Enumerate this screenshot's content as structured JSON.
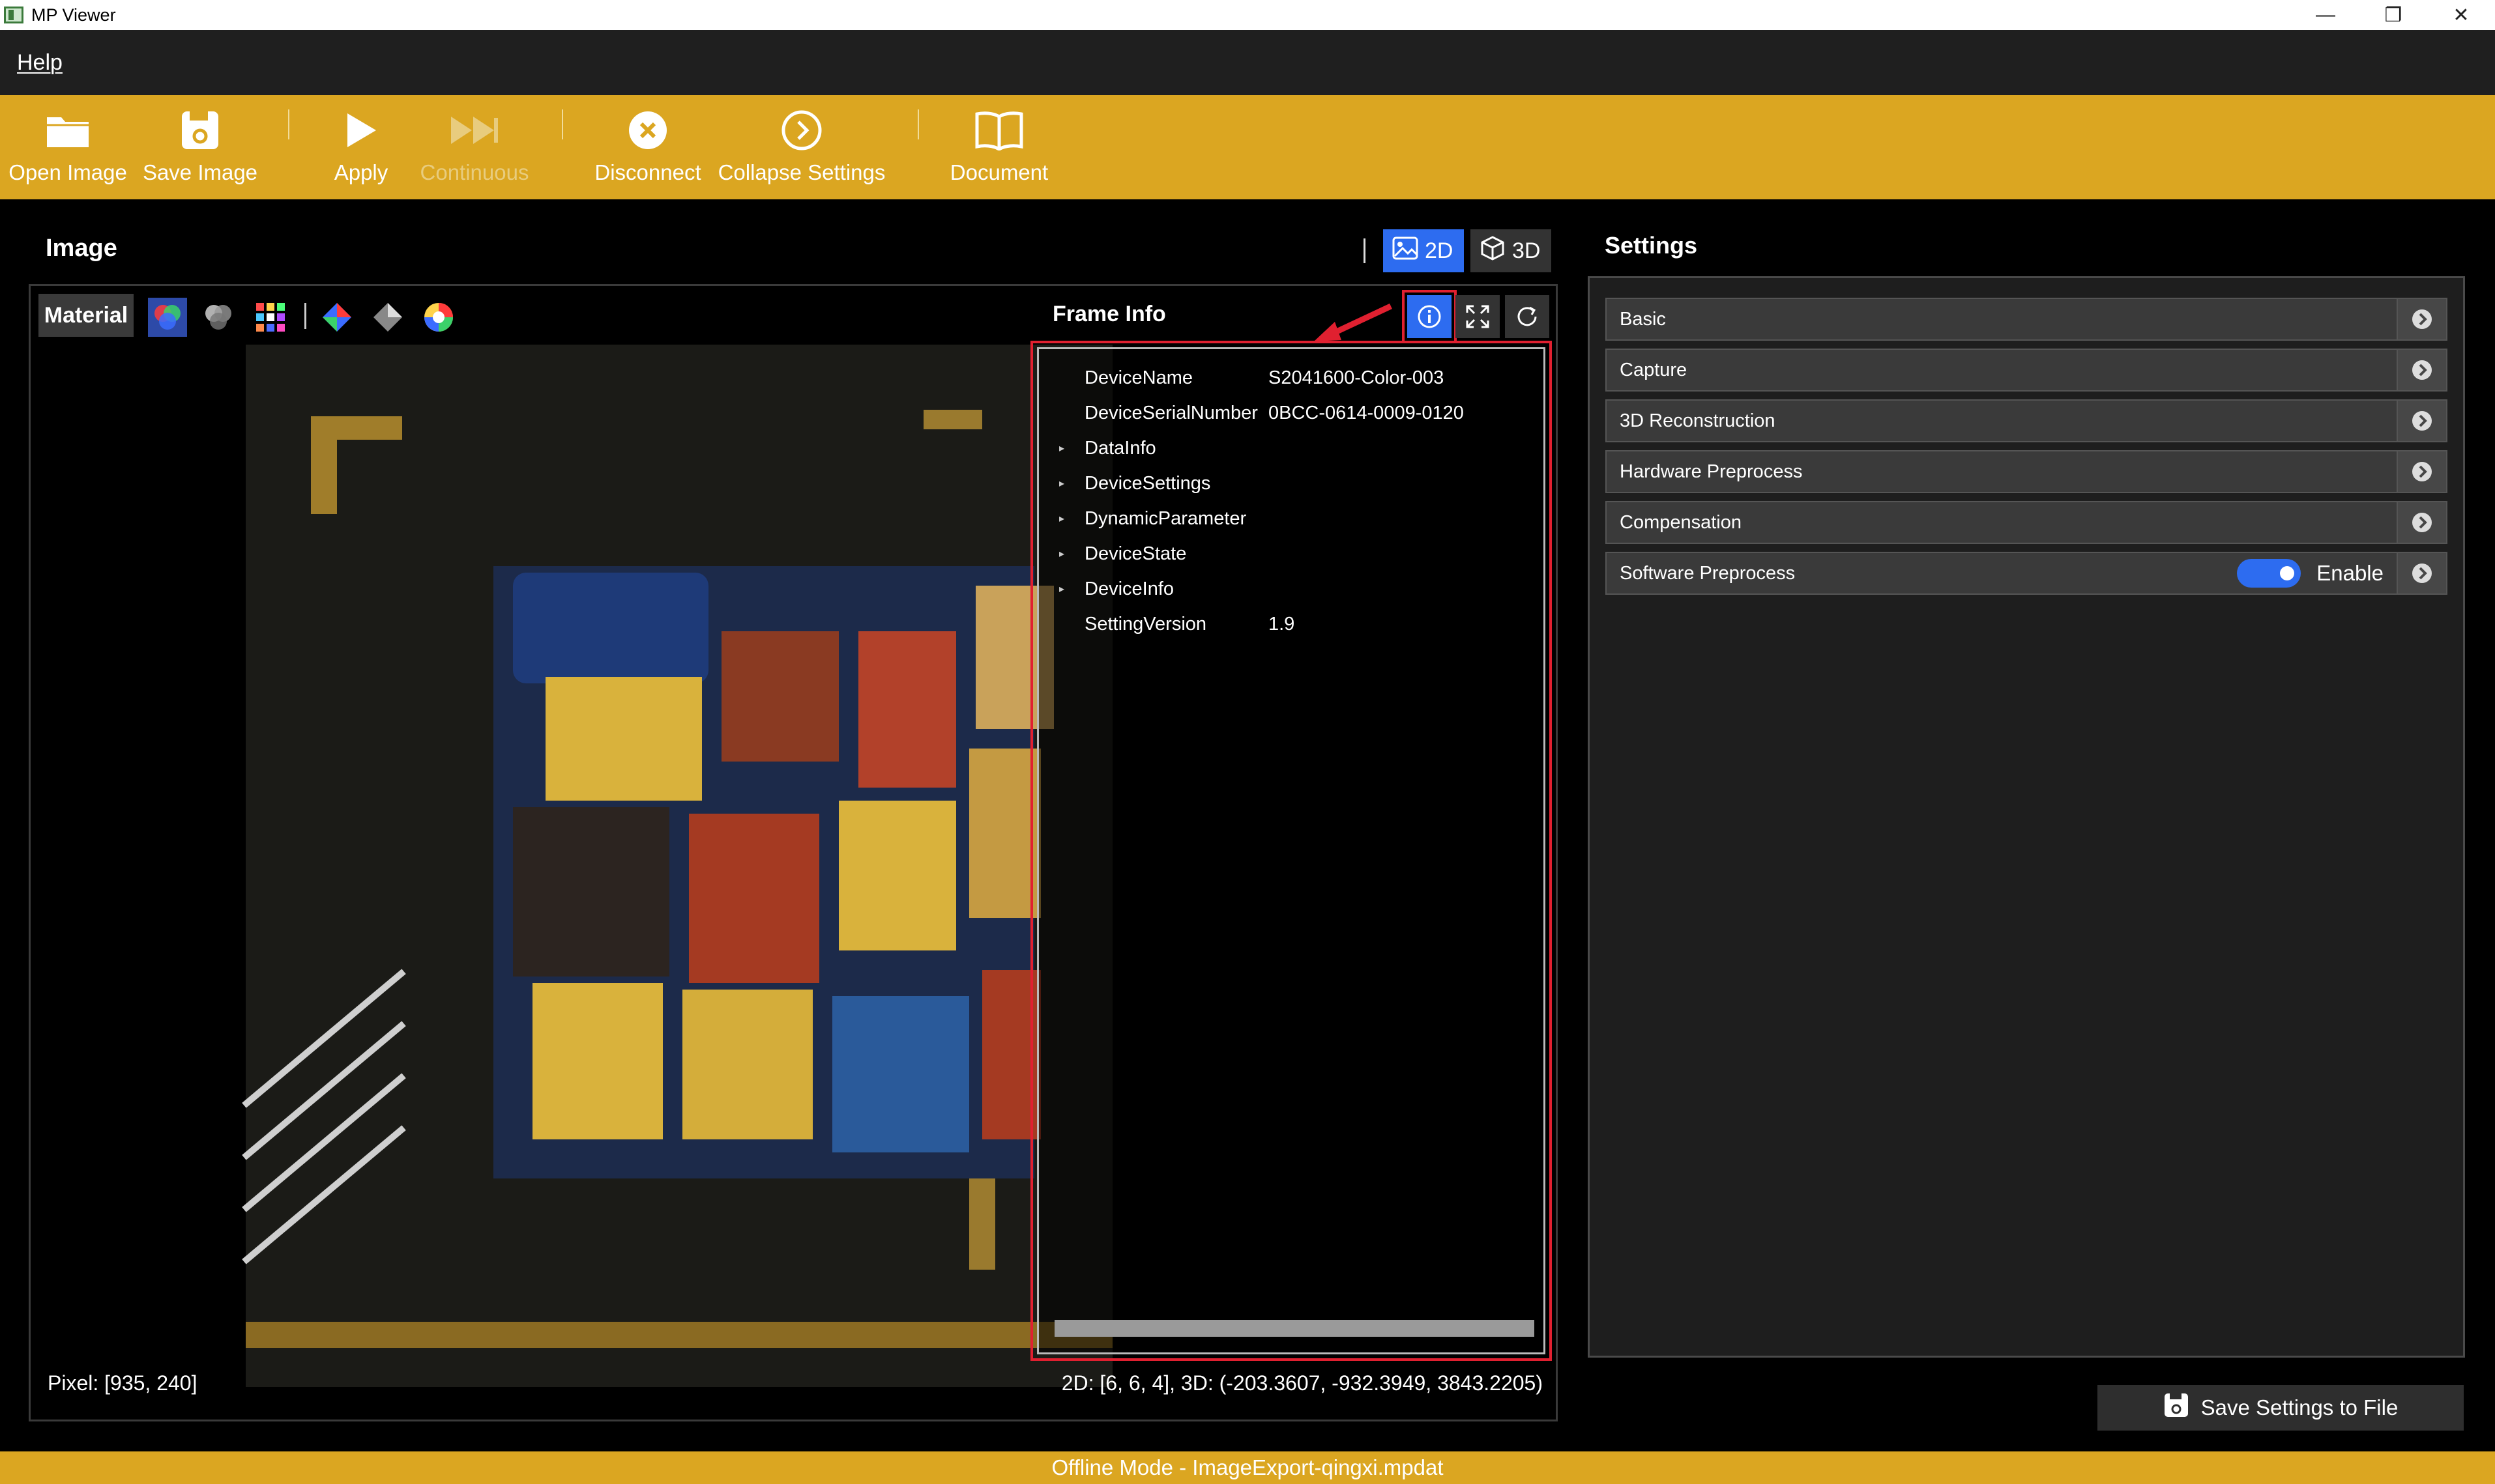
{
  "window": {
    "title": "MP Viewer",
    "minimize": "—",
    "restore": "❐",
    "close": "✕"
  },
  "menu": {
    "help": "Help"
  },
  "toolbar": {
    "open_image": "Open Image",
    "save_image": "Save Image",
    "apply": "Apply",
    "continuous": "Continuous",
    "disconnect": "Disconnect",
    "collapse_settings": "Collapse Settings",
    "document": "Document"
  },
  "image_panel": {
    "title": "Image",
    "mode_2d": "2D",
    "mode_3d": "3D",
    "material": "Material",
    "frame_info_title": "Frame Info",
    "frame_info": [
      {
        "key": "DeviceName",
        "value": "S2041600-Color-003",
        "expandable": false
      },
      {
        "key": "DeviceSerialNumber",
        "value": "0BCC-0614-0009-0120",
        "expandable": false
      },
      {
        "key": "DataInfo",
        "value": "",
        "expandable": true
      },
      {
        "key": "DeviceSettings",
        "value": "",
        "expandable": true
      },
      {
        "key": "DynamicParameter",
        "value": "",
        "expandable": true
      },
      {
        "key": "DeviceState",
        "value": "",
        "expandable": true
      },
      {
        "key": "DeviceInfo",
        "value": "",
        "expandable": true
      },
      {
        "key": "SettingVersion",
        "value": "1.9",
        "expandable": false
      }
    ],
    "pixel": "Pixel: [935, 240]",
    "coords": "2D: [6, 6, 4], 3D: (-203.3607, -932.3949, 3843.2205)"
  },
  "settings": {
    "title": "Settings",
    "items": [
      {
        "label": "Basic"
      },
      {
        "label": "Capture"
      },
      {
        "label": "3D Reconstruction"
      },
      {
        "label": "Hardware Preprocess"
      },
      {
        "label": "Compensation"
      },
      {
        "label": "Software Preprocess",
        "toggle": true,
        "toggle_label": "Enable"
      }
    ],
    "save_button": "Save Settings to File"
  },
  "status": {
    "text": "Offline Mode - ImageExport-qingxi.mpdat"
  },
  "colors": {
    "accent": "#dba621",
    "selected": "#2d6cf0",
    "highlight": "#e02030"
  }
}
